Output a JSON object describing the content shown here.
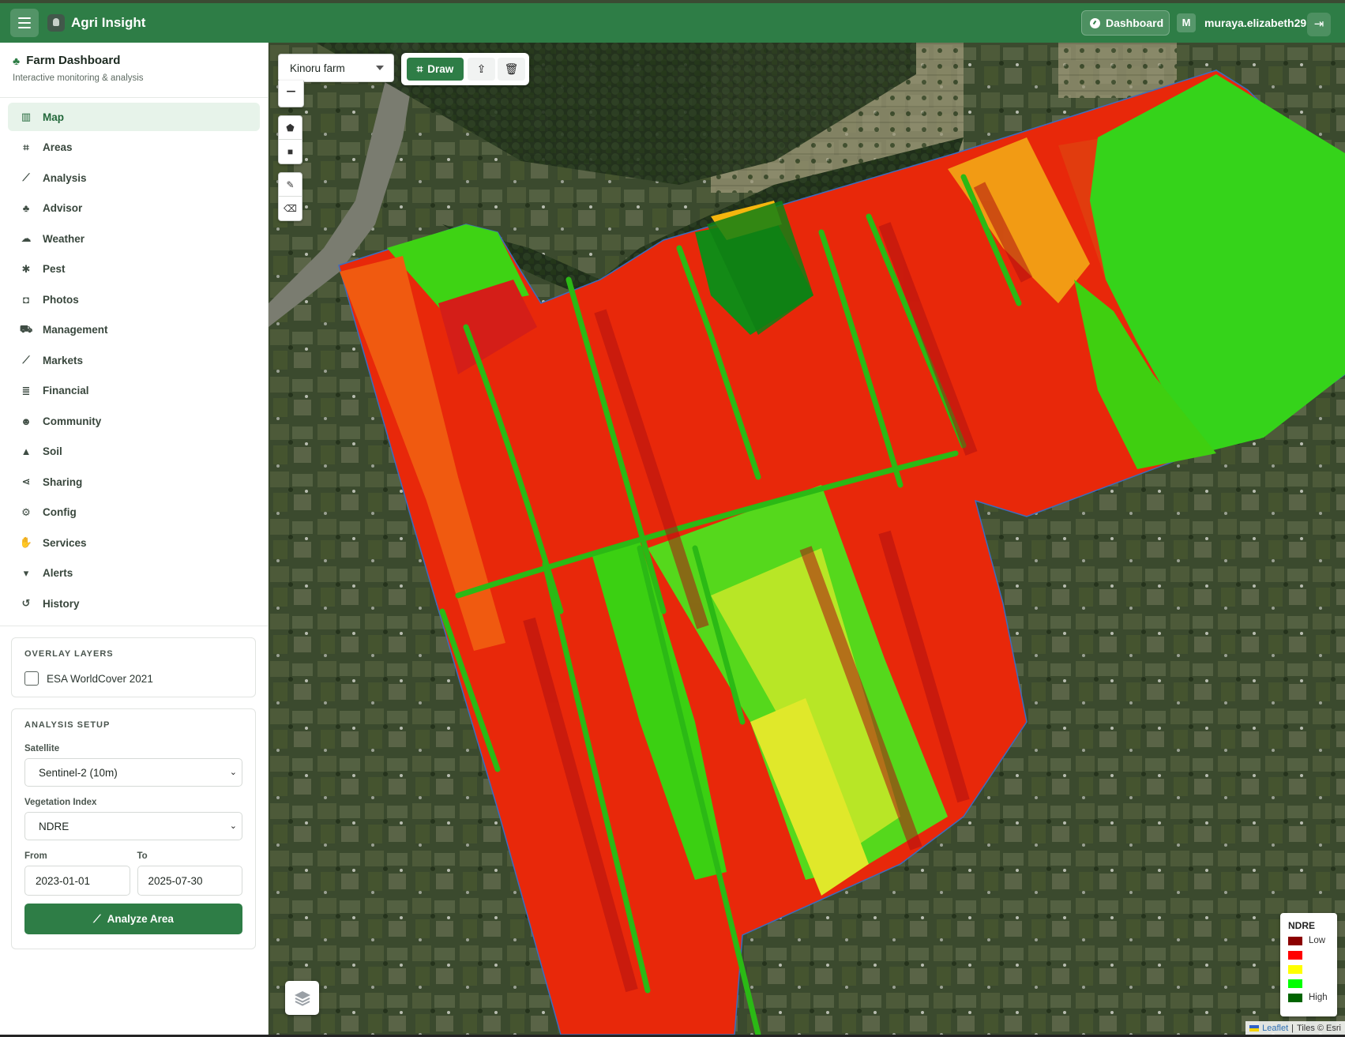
{
  "header": {
    "app_name": "Agri Insight",
    "dashboard_label": "Dashboard",
    "avatar_initial": "M",
    "username": "muraya.elizabeth29"
  },
  "sidebar": {
    "title": "Farm Dashboard",
    "subtitle": "Interactive monitoring & analysis",
    "items": [
      {
        "label": "Map",
        "icon": "map-icon",
        "glyph": "▥"
      },
      {
        "label": "Areas",
        "icon": "draw-polygon-icon",
        "glyph": "⌗"
      },
      {
        "label": "Analysis",
        "icon": "chart-line-icon",
        "glyph": "⟋"
      },
      {
        "label": "Advisor",
        "icon": "seedling-icon",
        "glyph": "♣"
      },
      {
        "label": "Weather",
        "icon": "cloud-sun-icon",
        "glyph": "☁"
      },
      {
        "label": "Pest",
        "icon": "bug-icon",
        "glyph": "✱"
      },
      {
        "label": "Photos",
        "icon": "camera-icon",
        "glyph": "◘"
      },
      {
        "label": "Management",
        "icon": "tractor-icon",
        "glyph": "⛟"
      },
      {
        "label": "Markets",
        "icon": "chart-line-icon",
        "glyph": "⟋"
      },
      {
        "label": "Financial",
        "icon": "coins-icon",
        "glyph": "≣"
      },
      {
        "label": "Community",
        "icon": "users-icon",
        "glyph": "☻"
      },
      {
        "label": "Soil",
        "icon": "mountain-icon",
        "glyph": "▲"
      },
      {
        "label": "Sharing",
        "icon": "share-nodes-icon",
        "glyph": "⋖"
      },
      {
        "label": "Config",
        "icon": "gear-icon",
        "glyph": "⚙"
      },
      {
        "label": "Services",
        "icon": "handshake-icon",
        "glyph": "✋"
      },
      {
        "label": "Alerts",
        "icon": "bell-icon",
        "glyph": "▾"
      },
      {
        "label": "History",
        "icon": "history-icon",
        "glyph": "↺"
      }
    ],
    "active_item": "Map"
  },
  "overlay_layers": {
    "title": "OVERLAY LAYERS",
    "items": [
      {
        "label": "ESA WorldCover 2021",
        "checked": false
      }
    ]
  },
  "analysis_setup": {
    "title": "ANALYSIS SETUP",
    "satellite_label": "Satellite",
    "satellite_value": "Sentinel-2 (10m)",
    "index_label": "Vegetation Index",
    "index_value": "NDRE",
    "from_label": "From",
    "from_value": "2023-01-01",
    "to_label": "To",
    "to_value": "2025-07-30",
    "button_label": "Analyze Area"
  },
  "map": {
    "farm_select_value": "Kinoru farm",
    "zoom_out_symbol": "−",
    "draw_label": "Draw",
    "legend": {
      "title": "NDRE",
      "items": [
        {
          "color": "#8b0000",
          "label": "Low"
        },
        {
          "color": "#ff0000",
          "label": ""
        },
        {
          "color": "#ffff00",
          "label": ""
        },
        {
          "color": "#00ff00",
          "label": ""
        },
        {
          "color": "#006400",
          "label": "High"
        }
      ]
    },
    "attribution": {
      "leaflet": "Leaflet",
      "separator": "|",
      "tiles": "Tiles © Esri"
    }
  },
  "colors": {
    "brand": "#2e7d46",
    "active_nav_bg": "#e7f3ea"
  }
}
